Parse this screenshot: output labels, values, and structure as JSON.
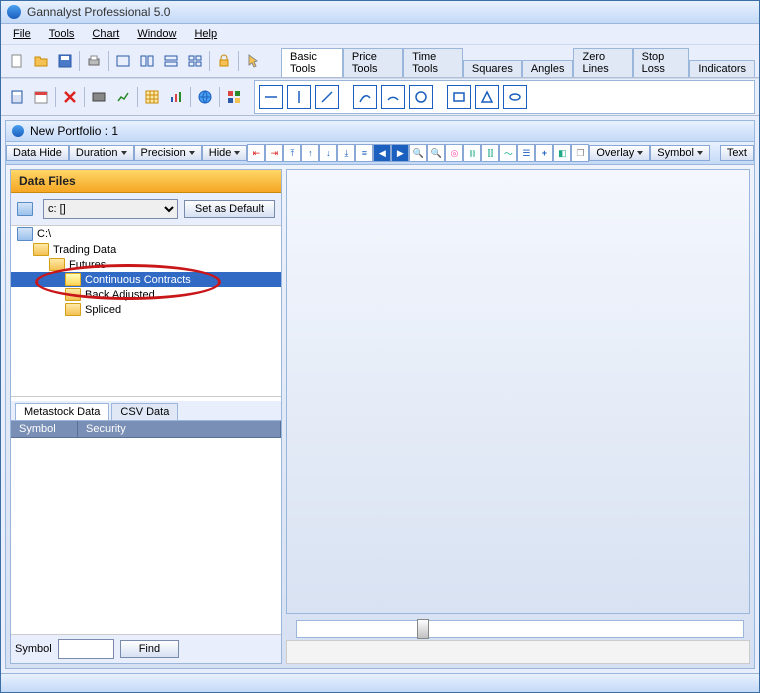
{
  "app": {
    "title": "Gannalyst Professional 5.0"
  },
  "menu": {
    "file": "File",
    "tools": "Tools",
    "chart": "Chart",
    "window": "Window",
    "help": "Help"
  },
  "tool_tabs": {
    "items": [
      "Basic Tools",
      "Price Tools",
      "Time Tools",
      "Squares",
      "Angles",
      "Zero Lines",
      "Stop Loss",
      "Indicators"
    ],
    "active": 0
  },
  "portfolio": {
    "title": "New Portfolio : 1"
  },
  "ctrl": {
    "datahide": "Data Hide",
    "duration": "Duration",
    "precision": "Precision",
    "hide": "Hide",
    "overlay": "Overlay",
    "symbol": "Symbol",
    "text": "Text"
  },
  "side": {
    "header": "Data Files",
    "drive_label": "c: []",
    "set_default": "Set as Default",
    "tree": [
      {
        "label": "C:\\",
        "depth": 0,
        "icon": "drive"
      },
      {
        "label": "Trading Data",
        "depth": 1,
        "icon": "folder"
      },
      {
        "label": "Futures",
        "depth": 2,
        "icon": "folder"
      },
      {
        "label": "Continuous Contracts",
        "depth": 3,
        "icon": "folder",
        "selected": true,
        "circled": true
      },
      {
        "label": "Back Adjusted",
        "depth": 3,
        "icon": "folder"
      },
      {
        "label": "Spliced",
        "depth": 3,
        "icon": "folder"
      }
    ],
    "data_tabs": {
      "metastock": "Metastock Data",
      "csv": "CSV Data"
    },
    "grid_cols": {
      "symbol": "Symbol",
      "security": "Security"
    },
    "find_label": "Symbol",
    "find_value": "",
    "find_btn": "Find"
  }
}
